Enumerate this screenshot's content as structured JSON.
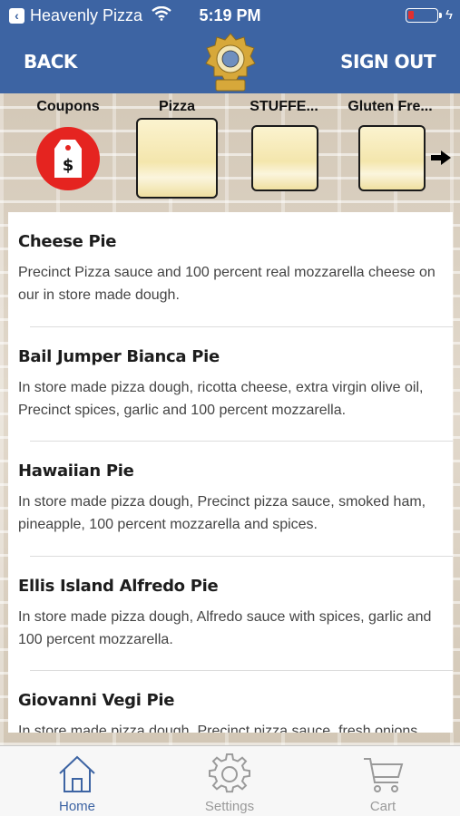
{
  "status_bar": {
    "back_app": "Heavenly Pizza",
    "time": "5:19 PM",
    "battery_level": 0.2
  },
  "nav": {
    "back_label": "BACK",
    "sign_out_label": "SIGN OUT",
    "logo_icon": "police-badge-logo"
  },
  "categories": [
    {
      "label": "Coupons",
      "icon": "coupon-tag-icon"
    },
    {
      "label": "Pizza"
    },
    {
      "label": "STUFFE..."
    },
    {
      "label": "Gluten Fre..."
    }
  ],
  "menu_items": [
    {
      "title": "Cheese Pie",
      "description": "Precinct Pizza sauce and 100 percent real mozzarella cheese on our in store made dough."
    },
    {
      "title": "Bail Jumper Bianca Pie",
      "description": "In store made pizza dough, ricotta cheese, extra virgin olive oil, Precinct spices, garlic and 100 percent mozzarella."
    },
    {
      "title": "Hawaiian Pie",
      "description": "In store made pizza dough, Precinct pizza sauce, smoked ham, pineapple, 100 percent mozzarella and spices."
    },
    {
      "title": "Ellis Island Alfredo Pie",
      "description": "In store made pizza dough, Alfredo sauce with spices, garlic and 100 percent mozzarella."
    },
    {
      "title": "Giovanni Vegi Pie",
      "description": "In store made pizza dough, Precinct pizza sauce, fresh onions,"
    }
  ],
  "tabs": [
    {
      "label": "Home",
      "icon": "home-icon",
      "active": true
    },
    {
      "label": "Settings",
      "icon": "gear-icon",
      "active": false
    },
    {
      "label": "Cart",
      "icon": "cart-icon",
      "active": false
    }
  ],
  "colors": {
    "header_blue": "#3d64a3",
    "coupon_red": "#e52420",
    "active_tab": "#3d64a3",
    "inactive_tab": "#9a9a9a"
  }
}
